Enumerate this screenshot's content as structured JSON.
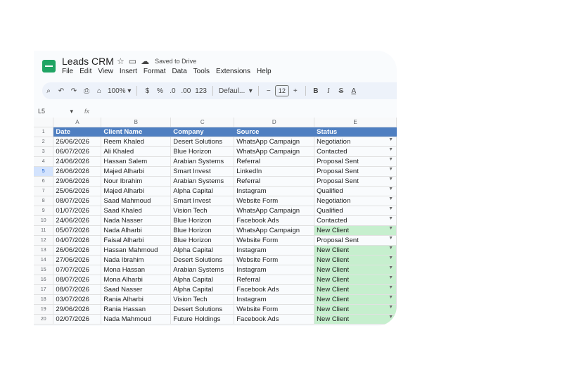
{
  "app": {
    "title": "Leads CRM",
    "saved_status": "Saved to Drive",
    "menu": [
      "File",
      "Edit",
      "View",
      "Insert",
      "Format",
      "Data",
      "Tools",
      "Extensions",
      "Help"
    ]
  },
  "toolbar": {
    "zoom": "100%",
    "currency": "$",
    "percent": "%",
    "decrease_decimal": ".0",
    "increase_decimal": ".00",
    "number_format": "123",
    "font": "Defaul...",
    "font_size": "12",
    "bold": "B",
    "italic": "I",
    "strike": "S",
    "text_color": "A"
  },
  "formula_bar": {
    "cell_ref": "L5",
    "fx": "fx"
  },
  "sheet": {
    "columns": [
      "A",
      "B",
      "C",
      "D",
      "E"
    ],
    "headers": [
      "Date",
      "Client Name",
      "Company",
      "Source",
      "Status"
    ],
    "selected_row": 5,
    "row_numbers": [
      "1",
      "2",
      "3",
      "4",
      "5",
      "6",
      "7",
      "8",
      "9",
      "10",
      "11",
      "12",
      "13",
      "14",
      "15",
      "16",
      "17",
      "18",
      "19",
      "20"
    ],
    "rows": [
      [
        "26/06/2026",
        "Reem Khaled",
        "Desert Solutions",
        "WhatsApp Campaign",
        "Negotiation"
      ],
      [
        "06/07/2026",
        "Ali Khaled",
        "Blue Horizon",
        "WhatsApp Campaign",
        "Contacted"
      ],
      [
        "24/06/2026",
        "Hassan Salem",
        "Arabian Systems",
        "Referral",
        "Proposal Sent"
      ],
      [
        "26/06/2026",
        "Majed Alharbi",
        "Smart Invest",
        "LinkedIn",
        "Proposal Sent"
      ],
      [
        "29/06/2026",
        "Nour Ibrahim",
        "Arabian Systems",
        "Referral",
        "Proposal Sent"
      ],
      [
        "25/06/2026",
        "Majed Alharbi",
        "Alpha Capital",
        "Instagram",
        "Qualified"
      ],
      [
        "08/07/2026",
        "Saad Mahmoud",
        "Smart Invest",
        "Website Form",
        "Negotiation"
      ],
      [
        "01/07/2026",
        "Saad Khaled",
        "Vision Tech",
        "WhatsApp Campaign",
        "Qualified"
      ],
      [
        "24/06/2026",
        "Nada Nasser",
        "Blue Horizon",
        "Facebook Ads",
        "Contacted"
      ],
      [
        "05/07/2026",
        "Nada Alharbi",
        "Blue Horizon",
        "WhatsApp Campaign",
        "New Client"
      ],
      [
        "04/07/2026",
        "Faisal Alharbi",
        "Blue Horizon",
        "Website Form",
        "Proposal Sent"
      ],
      [
        "26/06/2026",
        "Hassan Mahmoud",
        "Alpha Capital",
        "Instagram",
        "New Client"
      ],
      [
        "27/06/2026",
        "Nada Ibrahim",
        "Desert Solutions",
        "Website Form",
        "New Client"
      ],
      [
        "07/07/2026",
        "Mona Hassan",
        "Arabian Systems",
        "Instagram",
        "New Client"
      ],
      [
        "08/07/2026",
        "Mona Alharbi",
        "Alpha Capital",
        "Referral",
        "New Client"
      ],
      [
        "08/07/2026",
        "Saad Nasser",
        "Alpha Capital",
        "Facebook Ads",
        "New Client"
      ],
      [
        "03/07/2026",
        "Rania Alharbi",
        "Vision Tech",
        "Instagram",
        "New Client"
      ],
      [
        "29/06/2026",
        "Rania Hassan",
        "Desert Solutions",
        "Website Form",
        "New Client"
      ],
      [
        "02/07/2026",
        "Nada Mahmoud",
        "Future Holdings",
        "Facebook Ads",
        "New Client"
      ]
    ]
  },
  "colors": {
    "header_bg": "#4f7fc1",
    "new_client_bg": "#c6efce",
    "logo": "#20a464"
  }
}
